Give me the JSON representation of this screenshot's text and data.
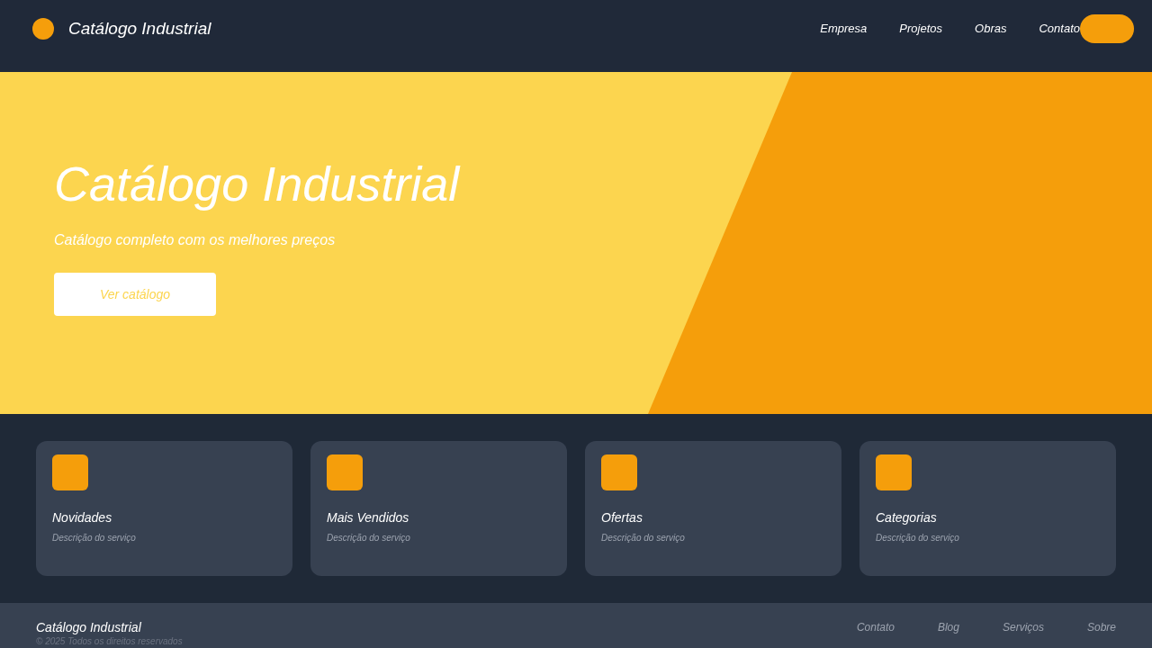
{
  "header": {
    "logo_text": "Catálogo Industrial",
    "nav": [
      "Empresa",
      "Projetos",
      "Obras",
      "Contato"
    ]
  },
  "hero": {
    "title": "Catálogo Industrial",
    "subtitle": "Catálogo completo com os melhores preços",
    "button": "Ver catálogo"
  },
  "cards": [
    {
      "title": "Novidades",
      "description": "Descrição do serviço"
    },
    {
      "title": "Mais Vendidos",
      "description": "Descrição do serviço"
    },
    {
      "title": "Ofertas",
      "description": "Descrição do serviço"
    },
    {
      "title": "Categorias",
      "description": "Descrição do serviço"
    }
  ],
  "footer": {
    "brand": "Catálogo Industrial",
    "copyright": "© 2025 Todos os direitos reservados",
    "links": [
      "Contato",
      "Blog",
      "Serviços",
      "Sobre"
    ]
  }
}
